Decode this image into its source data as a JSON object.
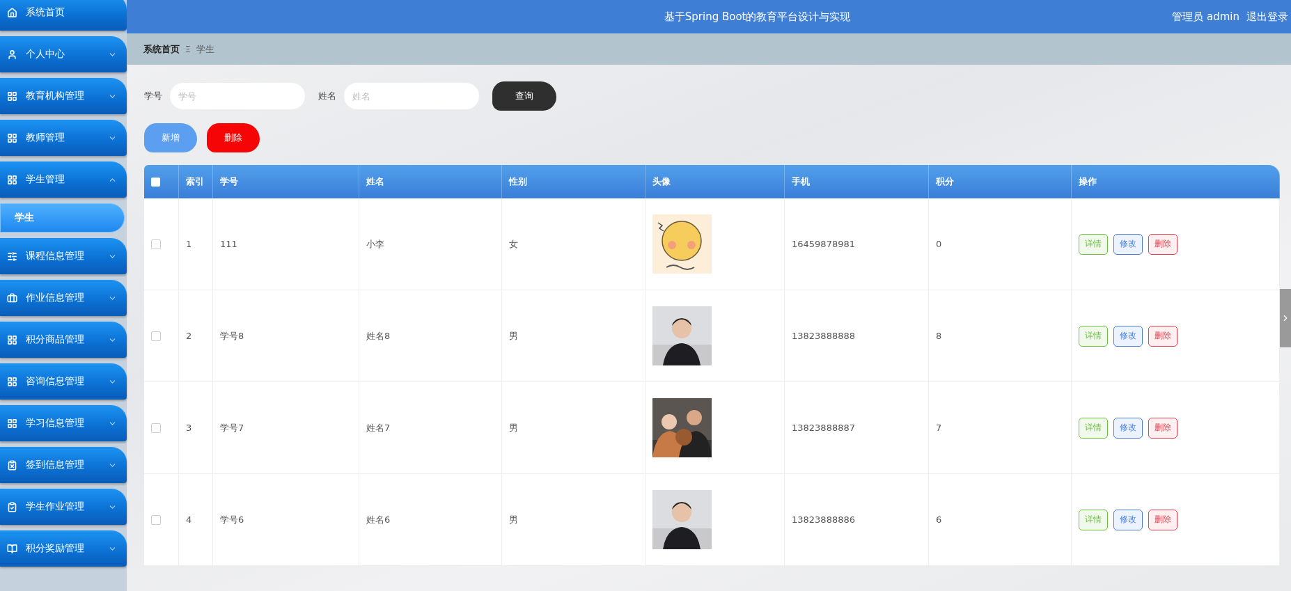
{
  "sidebar": {
    "items": [
      {
        "label": "系统首页",
        "kind": "link",
        "selected": false
      },
      {
        "label": "个人中心",
        "kind": "menu",
        "expanded": false,
        "selected": false
      },
      {
        "label": "教育机构管理",
        "kind": "menu",
        "expanded": false,
        "selected": false
      },
      {
        "label": "教师管理",
        "kind": "menu",
        "expanded": false,
        "selected": false
      },
      {
        "label": "学生管理",
        "kind": "menu",
        "expanded": true,
        "selected": false,
        "children": [
          {
            "label": "学生",
            "selected": true
          }
        ]
      },
      {
        "label": "课程信息管理",
        "kind": "menu",
        "expanded": false,
        "selected": false
      },
      {
        "label": "作业信息管理",
        "kind": "menu",
        "expanded": false,
        "selected": false
      },
      {
        "label": "积分商品管理",
        "kind": "menu",
        "expanded": false,
        "selected": false
      },
      {
        "label": "咨询信息管理",
        "kind": "menu",
        "expanded": false,
        "selected": false
      },
      {
        "label": "学习信息管理",
        "kind": "menu",
        "expanded": false,
        "selected": false
      },
      {
        "label": "签到信息管理",
        "kind": "menu",
        "expanded": false,
        "selected": false
      },
      {
        "label": "学生作业管理",
        "kind": "menu",
        "expanded": false,
        "selected": false
      },
      {
        "label": "积分奖励管理",
        "kind": "menu",
        "expanded": false,
        "selected": false
      }
    ]
  },
  "header": {
    "title": "基于Spring Boot的教育平台设计与实现",
    "user": "管理员 admin",
    "logout": "退出登录"
  },
  "breadcrumb": {
    "items": [
      "系统首页",
      "学生"
    ],
    "separator": "Ξ"
  },
  "search": {
    "fields": [
      {
        "label": "学号",
        "placeholder": "学号"
      },
      {
        "label": "姓名",
        "placeholder": "姓名"
      }
    ],
    "button": "查询"
  },
  "actions": [
    {
      "label": "新增",
      "kind": "add"
    },
    {
      "label": "删除",
      "kind": "delete"
    }
  ],
  "table": {
    "all_checked": false,
    "columns": [
      "索引",
      "学号",
      "姓名",
      "性别",
      "头像",
      "手机",
      "积分",
      "操作"
    ],
    "rows": [
      {
        "checked": false,
        "cells": [
          "1",
          "111",
          "小李",
          "女"
        ],
        "phone": "16459878981",
        "points": "0",
        "buttons": [
          "详情",
          "修改",
          "删除"
        ]
      },
      {
        "checked": false,
        "cells": [
          "2",
          "学号8",
          "姓名8",
          "男"
        ],
        "phone": "13823888888",
        "points": "8",
        "buttons": [
          "详情",
          "修改",
          "删除"
        ]
      },
      {
        "checked": false,
        "cells": [
          "3",
          "学号7",
          "姓名7",
          "男"
        ],
        "phone": "13823888887",
        "points": "7",
        "buttons": [
          "详情",
          "修改",
          "删除"
        ]
      },
      {
        "checked": false,
        "cells": [
          "4",
          "学号6",
          "姓名6",
          "男"
        ],
        "phone": "13823888886",
        "points": "6",
        "buttons": [
          "详情",
          "修改",
          "删除"
        ]
      }
    ]
  }
}
